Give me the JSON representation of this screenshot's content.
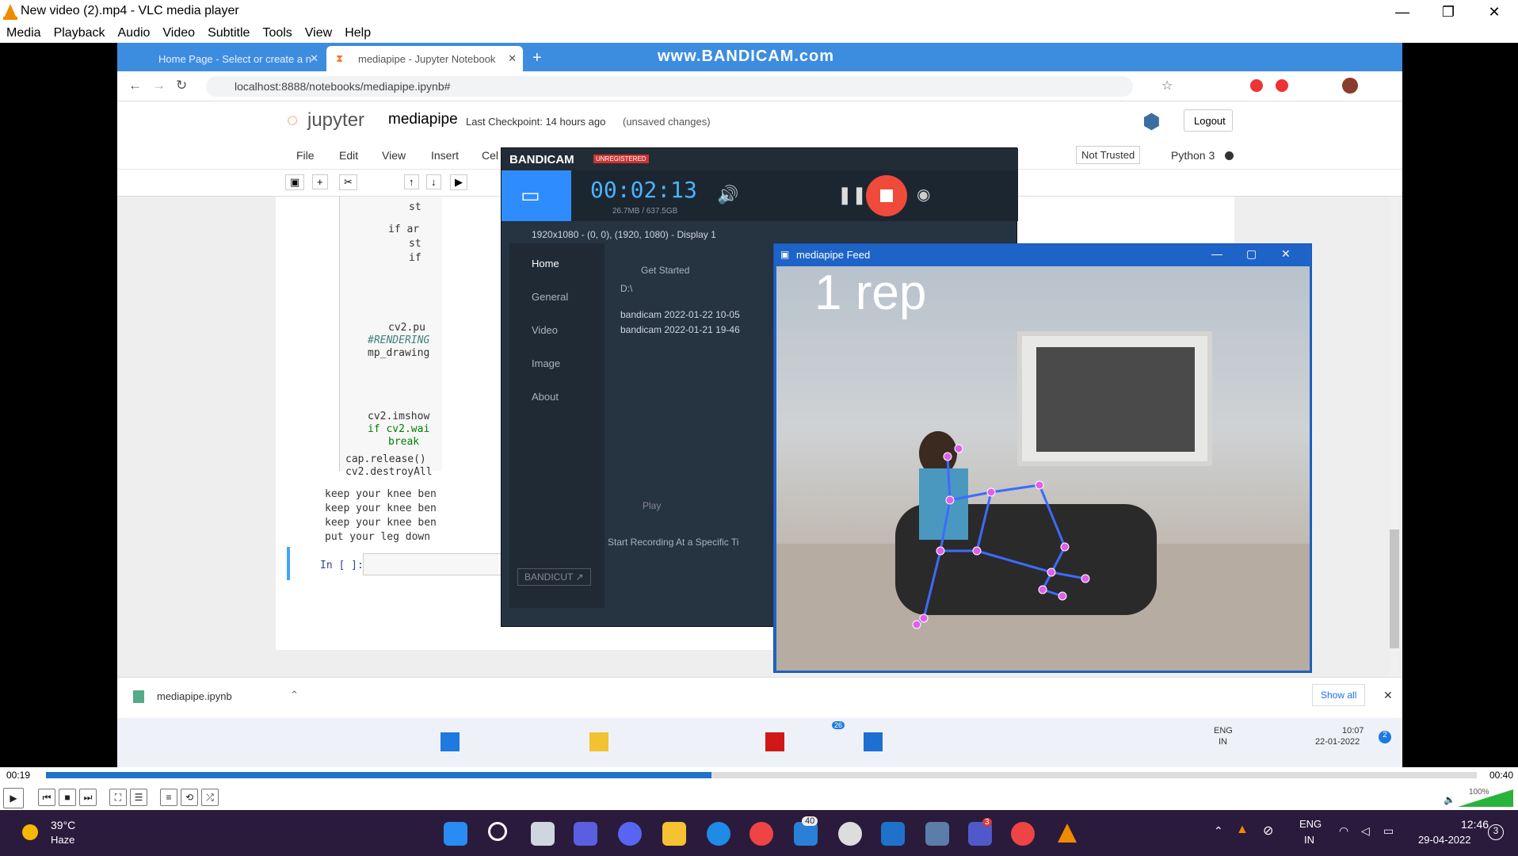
{
  "vlc": {
    "title": "New video (2).mp4 - VLC media player",
    "menu": [
      "Media",
      "Playback",
      "Audio",
      "Video",
      "Subtitle",
      "Tools",
      "View",
      "Help"
    ],
    "time_elapsed": "00:19",
    "time_total": "00:40",
    "progress": 0.465,
    "volume": "100%"
  },
  "chrome": {
    "tabs": [
      "Home Page - Select or create a n",
      "mediapipe - Jupyter Notebook"
    ],
    "watermark": "www.BANDICAM.com",
    "url": "localhost:8888/notebooks/mediapipe.ipynb#"
  },
  "jupyter": {
    "logo": "jupyter",
    "notebook_name": "mediapipe",
    "checkpoint": "Last Checkpoint: 14 hours ago",
    "unsaved": "(unsaved changes)",
    "logout": "Logout",
    "menu": [
      "File",
      "Edit",
      "View",
      "Insert",
      "Cel"
    ],
    "not_trusted": "Not Trusted",
    "kernel": "Python 3",
    "code": [
      "st",
      "if ar",
      "st",
      "if",
      "cv2.pu",
      "#RENDERING",
      "mp_drawing",
      "cv2.imshow",
      "if cv2.wai",
      "break",
      "cap.release()",
      "cv2.destroyAll"
    ],
    "output": [
      "keep your knee ben",
      "keep your knee ben",
      "keep your knee ben",
      "put your leg down"
    ],
    "prompt": "In [ ]:"
  },
  "bandicam": {
    "brand": "BANDICAM",
    "unregistered": "UNREGISTERED",
    "timer": "00:02:13",
    "size": "26.7MB / 637.5GB",
    "region": "1920x1080 - (0, 0), (1920, 1080) - Display 1",
    "nav": [
      "Home",
      "General",
      "Video",
      "Image",
      "About"
    ],
    "get_started": "Get Started",
    "path": "D:\\",
    "files": [
      "bandicam 2022-01-22 10-05",
      "bandicam 2022-01-21 19-46"
    ],
    "play": "Play",
    "bandicut": "BANDICUT ↗",
    "footer": "Start Recording At a Specific Ti"
  },
  "feed": {
    "title": "mediapipe Feed",
    "rep_text": "1 rep"
  },
  "download": {
    "file": "mediapipe.ipynb",
    "show_all": "Show all"
  },
  "inner_taskbar": {
    "lang": "ENG",
    "region": "IN",
    "time": "10:07",
    "date": "22-01-2022",
    "notif": "2",
    "badge": "26"
  },
  "taskbar": {
    "temp": "39°C",
    "weather": "Haze",
    "lang": "ENG",
    "region": "IN",
    "time": "12:46",
    "date": "29-04-2022",
    "notif": "3",
    "badge_store": "40",
    "badge_teams": "3"
  }
}
